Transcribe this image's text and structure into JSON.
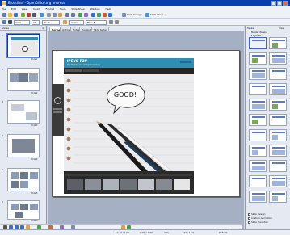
{
  "window": {
    "title": "Broadleaf - OpenOffice.org Impress"
  },
  "menu": [
    "File",
    "Edit",
    "View",
    "Insert",
    "Format",
    "Tools",
    "Slide Show",
    "Window",
    "Help"
  ],
  "toolbar2": {
    "font": "Arial",
    "size": "18",
    "color_label": "Black",
    "line_style": "Color",
    "fill_label": "Blue 8"
  },
  "toolbar1": {
    "slide_design_label": "Slide Design",
    "slide_show_label": "Slide Show"
  },
  "slides_pane": {
    "title": "Slides",
    "slides": [
      {
        "num": "1",
        "label": "Slide 1"
      },
      {
        "num": "2",
        "label": "Slide 2"
      },
      {
        "num": "3",
        "label": "Slide 3"
      },
      {
        "num": "4",
        "label": "Slide 4"
      },
      {
        "num": "5",
        "label": "Slide 5"
      },
      {
        "num": "6",
        "label": "Slide 6"
      }
    ]
  },
  "view_tabs": [
    "Normal",
    "Outline",
    "Notes",
    "Handout",
    "Slide Sorter"
  ],
  "slide": {
    "brand": "IPEVO P2V",
    "subtitle": "The Best Choice of Digital Camera",
    "bubble_text": "GOOD!"
  },
  "right_pane": {
    "title": "Tasks",
    "view_label": "View",
    "section": "Master Pages",
    "subsection": "Layouts"
  },
  "right_pane_options": [
    "Slide Design",
    "Custom Animation",
    "Slide Transition"
  ],
  "status": {
    "position": "12.36 / 1.00",
    "size": "0.00 x 0.00",
    "zoom": "76%",
    "slide": "Slide 1 / 6",
    "layout": "Default"
  },
  "colors": {
    "accent": "#2e8fb2",
    "title_bar": "#0a3ea8"
  }
}
